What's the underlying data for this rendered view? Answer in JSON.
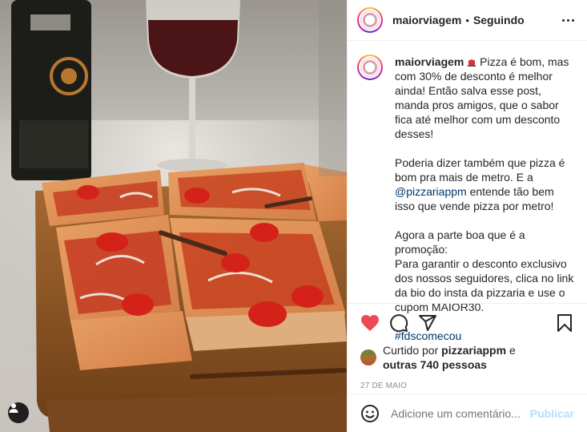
{
  "post": {
    "username": "maiorviagem",
    "separator": "•",
    "follow_status": "Seguindo"
  },
  "caption": {
    "username": "maiorviagem",
    "paragraph1": " Pizza é bom, mas com 30% de desconto é melhor ainda! Então salva esse post, manda pros amigos, que o sabor fica até melhor com um desconto desses!",
    "paragraph2_before": "Poderia dizer também que pizza é bom pra mais de metro. E a ",
    "paragraph2_mention": "@pizzariappm",
    "paragraph2_after": " entende tão bem isso que vende pizza por metro!",
    "paragraph3": "Agora a parte boa que é a promoção:\nPara garantir o desconto exclusivo dos nossos seguidores, clica no link da bio do insta da pizzaria e use o cupom MAIOR30.",
    "hashtag": "#fdscomecou"
  },
  "likes": {
    "prefix": "Curtido por ",
    "user": "pizzariappm",
    "middle": " e",
    "others": "outras 740 pessoas"
  },
  "date": "27 DE MAIO",
  "comment": {
    "placeholder": "Adicione um comentário...",
    "publish_label": "Publicar"
  },
  "icons": {
    "like": "heart-icon",
    "comment": "comment-icon",
    "share": "share-icon",
    "save": "bookmark-icon",
    "emoji": "emoji-icon",
    "user_tags": "user-icon",
    "more": "more-icon",
    "caption_emoji": "siren-icon"
  },
  "colors": {
    "like_red": "#ed4956",
    "link_blue": "#00376b",
    "publish_disabled": "#b2dffc",
    "muted": "#8e8e8e"
  }
}
